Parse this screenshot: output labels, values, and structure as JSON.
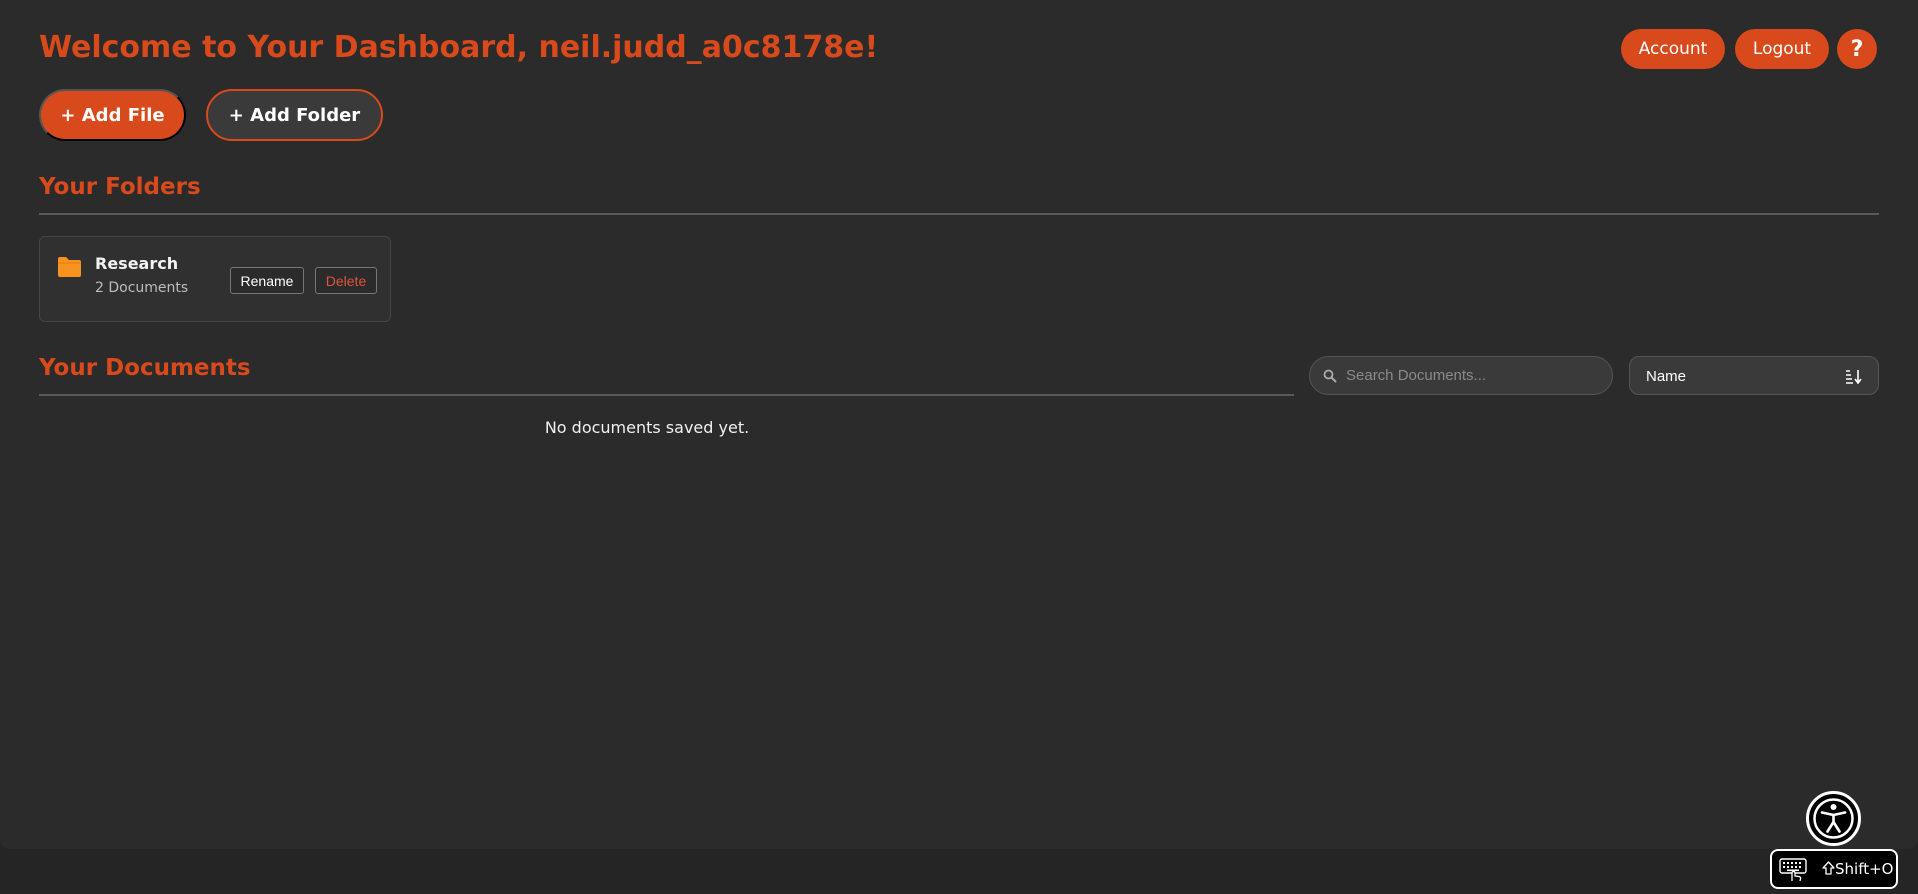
{
  "header": {
    "title": "Welcome to Your Dashboard, neil.judd_a0c8178e!",
    "account_label": "Account",
    "logout_label": "Logout",
    "help_label": "?"
  },
  "actions": {
    "add_file_label": "+ Add File",
    "add_folder_label": "+ Add Folder"
  },
  "folders": {
    "title": "Your Folders",
    "items": [
      {
        "name": "Research",
        "count": "2 Documents",
        "rename_label": "Rename",
        "delete_label": "Delete",
        "icon": "folder-icon"
      }
    ]
  },
  "documents": {
    "title": "Your Documents",
    "search_placeholder": "Search Documents...",
    "sort_value": "Name",
    "empty_message": "No documents saved yet."
  },
  "accessibility": {
    "shortcut_label": "Shift+O"
  },
  "colors": {
    "accent": "#d84a1b",
    "background": "#2b2b2b",
    "folder_icon": "#f7931e",
    "delete": "#e0533a"
  }
}
